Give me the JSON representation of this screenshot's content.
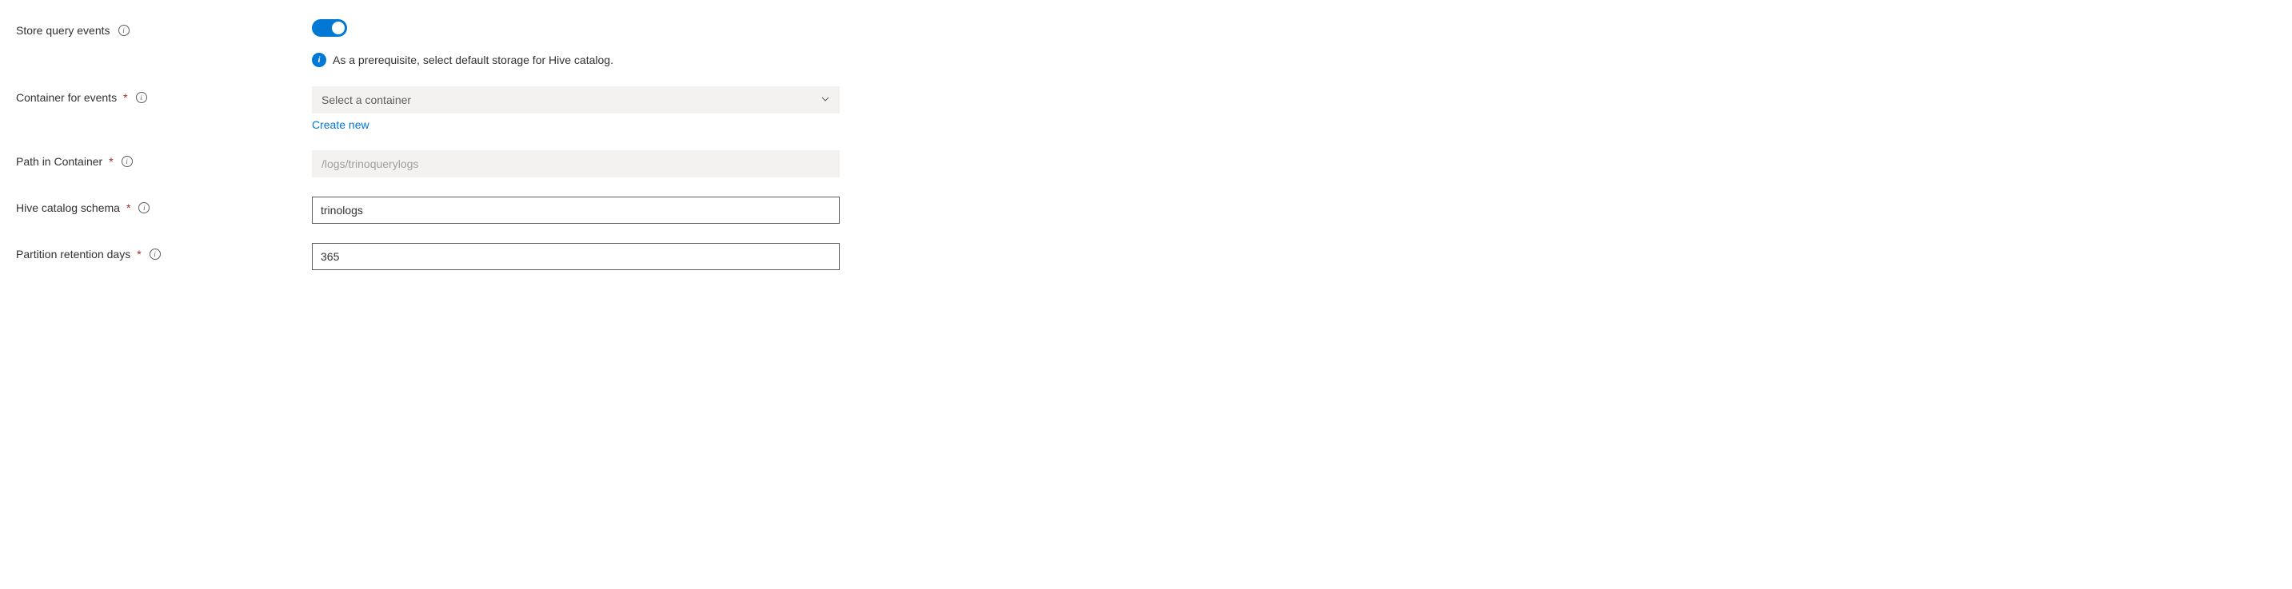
{
  "storeQueryEvents": {
    "label": "Store query events",
    "toggleOn": true,
    "infoMessage": "As a prerequisite, select default storage for Hive catalog."
  },
  "containerForEvents": {
    "label": "Container for events",
    "placeholder": "Select a container",
    "createNewLabel": "Create new"
  },
  "pathInContainer": {
    "label": "Path in Container",
    "placeholder": "/logs/trinoquerylogs"
  },
  "hiveCatalogSchema": {
    "label": "Hive catalog schema",
    "value": "trinologs"
  },
  "partitionRetentionDays": {
    "label": "Partition retention days",
    "value": "365"
  }
}
